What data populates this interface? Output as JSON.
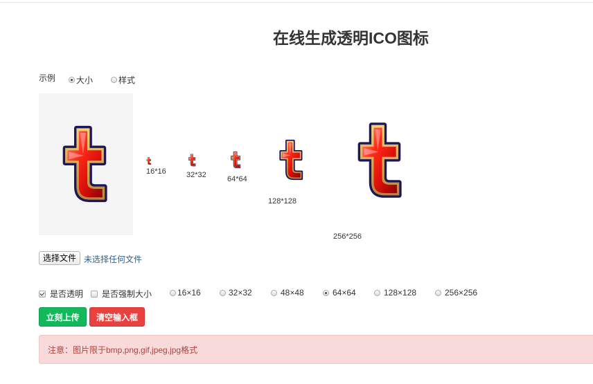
{
  "page": {
    "title": "在线生成透明ICO图标"
  },
  "example": {
    "label": "示例",
    "options": [
      {
        "label": "大小",
        "selected": true
      },
      {
        "label": "样式",
        "selected": false
      }
    ]
  },
  "previews": [
    {
      "label": "16*16"
    },
    {
      "label": "32*32"
    },
    {
      "label": "64*64"
    },
    {
      "label": "128*128"
    },
    {
      "label": "256*256"
    }
  ],
  "file": {
    "button_label": "选择文件",
    "status_text": "未选择任何文件"
  },
  "options": {
    "transparent": {
      "label": "是否透明",
      "checked": true
    },
    "force_size": {
      "label": "是否强制大小",
      "checked": false
    },
    "sizes": [
      {
        "label": "16×16",
        "selected": false
      },
      {
        "label": "32×32",
        "selected": false
      },
      {
        "label": "48×48",
        "selected": false
      },
      {
        "label": "64×64",
        "selected": true
      },
      {
        "label": "128×128",
        "selected": false
      },
      {
        "label": "256×256",
        "selected": false
      }
    ]
  },
  "actions": {
    "upload_label": "立刻上传",
    "clear_label": "清空输入框"
  },
  "notice": {
    "text": "注意：图片限于bmp,png,gif,jpeg,jpg格式"
  },
  "colors": {
    "upload": "#13b85b",
    "clear": "#e8413f",
    "alert_bg": "#f8dada",
    "alert_text": "#a94442"
  }
}
